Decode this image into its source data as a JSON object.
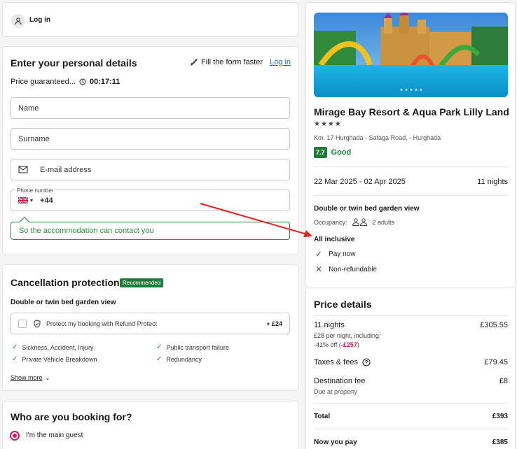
{
  "login": {
    "label": "Log in"
  },
  "details": {
    "title": "Enter your personal details",
    "fill_faster": "Fill the form faster",
    "login_link": "Log in",
    "price_guaranteed": "Price guaranteed...",
    "timer": "00:17:11",
    "name_placeholder": "Name",
    "surname_placeholder": "Surname",
    "email_placeholder": "E-mail address",
    "phone_label": "Phone number",
    "phone_code": "+44",
    "contact_hint": "So the accommodation can contact you"
  },
  "cancellation": {
    "title": "Cancellation protection",
    "badge": "Recommended",
    "room": "Double or twin bed garden view",
    "option_label": "Protect my booking with Refund Protect",
    "option_price": "+ £24",
    "benefits": [
      "Sickness, Accident, Injury",
      "Public transport failure",
      "Private Vehicle Breakdown",
      "Redundancy"
    ],
    "show_more": "Show more"
  },
  "who": {
    "title": "Who are you booking for?",
    "option": "I'm the main guest"
  },
  "hotel": {
    "name": "Mirage Bay Resort & Aqua Park Lilly Land",
    "stars": "★★★★",
    "address": "Km. 17 Hurghada - Safaga Road, - Hurghada",
    "rating": "7.7",
    "rating_label": "Good",
    "dates": "22 Mar 2025 - 02 Apr 2025",
    "nights": "11 nights",
    "room": "Double or twin bed garden view",
    "occupancy_label": "Occupancy:",
    "occupancy": "2 adults",
    "board": "All inclusive",
    "pay_now": "Pay now",
    "refund": "Non-refundable"
  },
  "price": {
    "title": "Price details",
    "nights_label": "11 nights",
    "nights_value": "£305.55",
    "per_night": "£28 per night, including:",
    "discount_prefix": "-41% off (",
    "discount_value": "-£257",
    "discount_suffix": ")",
    "taxes_label": "Taxes & fees",
    "taxes_value": "£79.45",
    "dest_label": "Destination fee",
    "dest_value": "£8",
    "dest_note": "Due at property",
    "total_label": "Total",
    "total_value": "£393",
    "now_label": "Now you pay",
    "now_value": "£385"
  },
  "colors": {
    "green": "#1e7c3a",
    "accent": "#d6135f",
    "link": "#1a6fc4",
    "arrow": "#e8211f"
  }
}
